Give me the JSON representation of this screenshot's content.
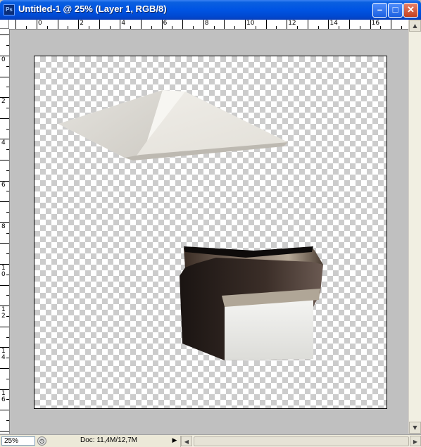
{
  "window": {
    "title": "Untitled-1 @ 25% (Layer 1, RGB/8)",
    "app_icon_text": "Ps",
    "minimize_glyph": "–",
    "maximize_glyph": "□",
    "close_glyph": "✕"
  },
  "rulers": {
    "top_labels": [
      "0",
      "2",
      "4",
      "6",
      "8",
      "10",
      "12",
      "14",
      "16"
    ],
    "left_labels": [
      "0",
      "2",
      "4",
      "6",
      "8",
      "1\n0",
      "1\n2",
      "1\n4",
      "1\n6"
    ]
  },
  "status": {
    "zoom": "25%",
    "doc_info": "Doc: 11,4M/12,7M",
    "menu_arrow": "▶"
  },
  "colors": {
    "titlebar": "#0054e3",
    "close_button": "#c4411f",
    "workspace": "#c0c0c0",
    "checker": "#cccccc"
  },
  "icons": {
    "app": "photoshop-icon",
    "minimize": "minimize-icon",
    "maximize": "maximize-icon",
    "close": "close-icon"
  }
}
